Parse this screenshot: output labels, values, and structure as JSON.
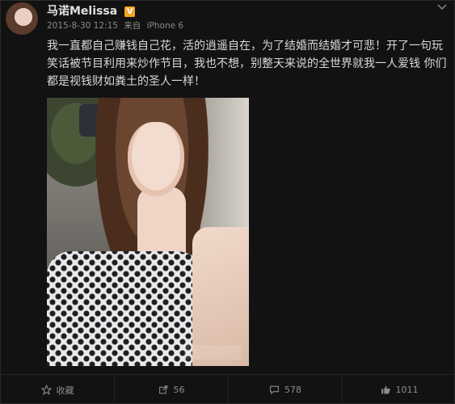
{
  "user": {
    "name": "马诺Melissa",
    "verified_badge": "V"
  },
  "meta": {
    "date": "2015-8-30 12:15",
    "source_prefix": "来自",
    "device": "iPhone 6"
  },
  "post": {
    "text": "我一直都自己赚钱自己花，活的逍遥自在，为了结婚而结婚才可悲！开了一句玩笑话被节目利用来炒作节目，我也不想，别整天来说的全世界就我一人爱钱 你们都是视钱财如粪土的圣人一样！"
  },
  "actions": [
    {
      "icon": "star-icon",
      "label": "收藏"
    },
    {
      "icon": "share-icon",
      "label": "56"
    },
    {
      "icon": "comment-icon",
      "label": "578"
    },
    {
      "icon": "thumbs-up-icon",
      "label": "1011"
    }
  ],
  "colors": {
    "background": "#121212",
    "text": "#d9d9d9",
    "muted": "#8a8a8a",
    "verified": "#f5a623"
  }
}
